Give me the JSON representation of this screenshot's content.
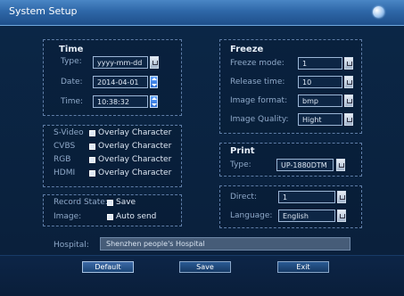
{
  "window": {
    "title": "System Setup"
  },
  "time": {
    "title": "Time",
    "type_label": "Type:",
    "type_value": "yyyy-mm-dd",
    "date_label": "Date:",
    "date_value": "2014-04-01",
    "time_label": "Time:",
    "time_value": "10:38:32"
  },
  "overlay": {
    "rows": [
      {
        "label": "S-Video",
        "text": "Overlay Character"
      },
      {
        "label": "CVBS",
        "text": "Overlay Character"
      },
      {
        "label": "RGB",
        "text": "Overlay Character"
      },
      {
        "label": "HDMI",
        "text": "Overlay Character"
      }
    ]
  },
  "record": {
    "label_1": "Record State:",
    "save_text": "Save",
    "label_2": "Image:",
    "auto_send_text": "Auto send"
  },
  "freeze": {
    "title": "Freeze",
    "mode_label": "Freeze mode:",
    "mode_value": "1",
    "release_label": "Release time:",
    "release_value": "10",
    "format_label": "Image format:",
    "format_value": "bmp",
    "quality_label": "Image Quality:",
    "quality_value": "Hight"
  },
  "print": {
    "title": "Print",
    "type_label": "Type:",
    "type_value": "UP-1880DTM"
  },
  "misc": {
    "direct_label": "Direct:",
    "direct_value": "1",
    "language_label": "Language:",
    "language_value": "English"
  },
  "hospital": {
    "label": "Hospital:",
    "value": "Shenzhen people's Hospital"
  },
  "buttons": {
    "default": "Default",
    "save": "Save",
    "exit": "Exit"
  }
}
